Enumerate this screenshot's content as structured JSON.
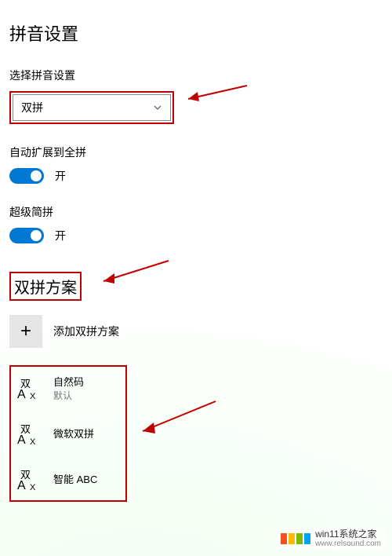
{
  "page": {
    "title": "拼音设置"
  },
  "pinyin_select": {
    "label": "选择拼音设置",
    "value": "双拼"
  },
  "auto_expand": {
    "label": "自动扩展到全拼",
    "state_text": "开",
    "on": true
  },
  "super_jian": {
    "label": "超级简拼",
    "state_text": "开",
    "on": true
  },
  "scheme_section": {
    "heading": "双拼方案",
    "add_label": "添加双拼方案"
  },
  "schemes": [
    {
      "name": "自然码",
      "sub": "默认"
    },
    {
      "name": "微软双拼",
      "sub": ""
    },
    {
      "name": "智能 ABC",
      "sub": ""
    }
  ],
  "watermark": {
    "title": "win11系统之家",
    "url": "www.relsound.com"
  },
  "icons": {
    "chevron_down": "chevron-down",
    "plus": "+"
  },
  "annotation_color": "#c00000"
}
